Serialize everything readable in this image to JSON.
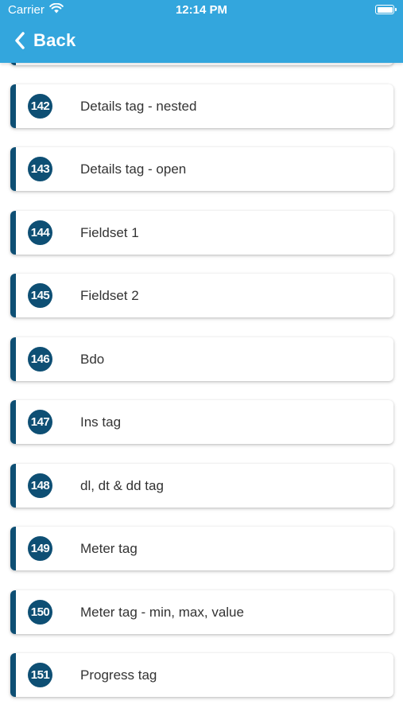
{
  "status_bar": {
    "carrier": "Carrier",
    "time": "12:14 PM",
    "wifi_icon": "wifi-icon",
    "battery_icon": "battery-icon"
  },
  "nav": {
    "back_label": "Back",
    "back_icon": "chevron-left-icon"
  },
  "colors": {
    "header_bg": "#33a6dd",
    "accent": "#0e4f74",
    "text": "#333333"
  },
  "items": [
    {
      "number": "142",
      "label": "Details tag - nested"
    },
    {
      "number": "143",
      "label": "Details tag - open"
    },
    {
      "number": "144",
      "label": "Fieldset 1"
    },
    {
      "number": "145",
      "label": "Fieldset 2"
    },
    {
      "number": "146",
      "label": "Bdo"
    },
    {
      "number": "147",
      "label": "Ins tag"
    },
    {
      "number": "148",
      "label": "dl, dt & dd tag"
    },
    {
      "number": "149",
      "label": "Meter tag"
    },
    {
      "number": "150",
      "label": "Meter tag - min, max, value"
    },
    {
      "number": "151",
      "label": "Progress tag"
    }
  ]
}
